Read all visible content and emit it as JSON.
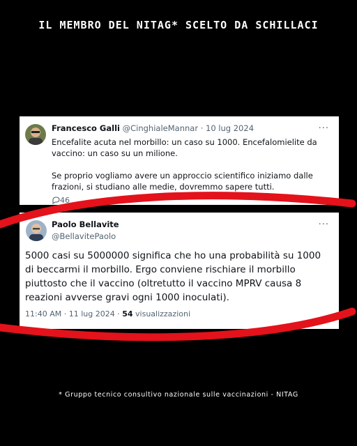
{
  "headline": "IL MEMBRO DEL NITAG* SCELTO DA SCHILLACI",
  "tweet1": {
    "author_name": "Francesco Galli",
    "author_handle": "@CinghialeMannar",
    "date": "· 10 lug 2024",
    "more": "···",
    "body_line1": "Encefalite acuta nel morbillo: un caso su 1000. Encefalomielite da vaccino: un caso su un milione.",
    "body_line2": "Se proprio vogliamo avere un approccio scientifico iniziamo dalle frazioni, si studiano alle medie, dovremmo sapere tutti.",
    "replies": "46"
  },
  "tweet2": {
    "author_name": "Paolo Bellavite",
    "author_handle": "@BellavitePaolo",
    "more": "···",
    "body": "5000 casi su 5000000 significa che ho una probabilità su 1000 di beccarmi il morbillo. Ergo conviene rischiare il morbillo piuttosto che il vaccino (oltretutto il vaccino MPRV causa 8 reazioni avverse gravi ogni 1000 inoculati).",
    "time": "11:40 AM · 11 lug 2024 ·",
    "views_count": "54",
    "views_label": "visualizzazioni"
  },
  "footnote": "* Gruppo tecnico consultivo nazionale sulle vaccinazioni - NITAG",
  "colors": {
    "background": "#000000",
    "card": "#ffffff",
    "swoosh": "#e3121b",
    "muted": "#536471"
  }
}
